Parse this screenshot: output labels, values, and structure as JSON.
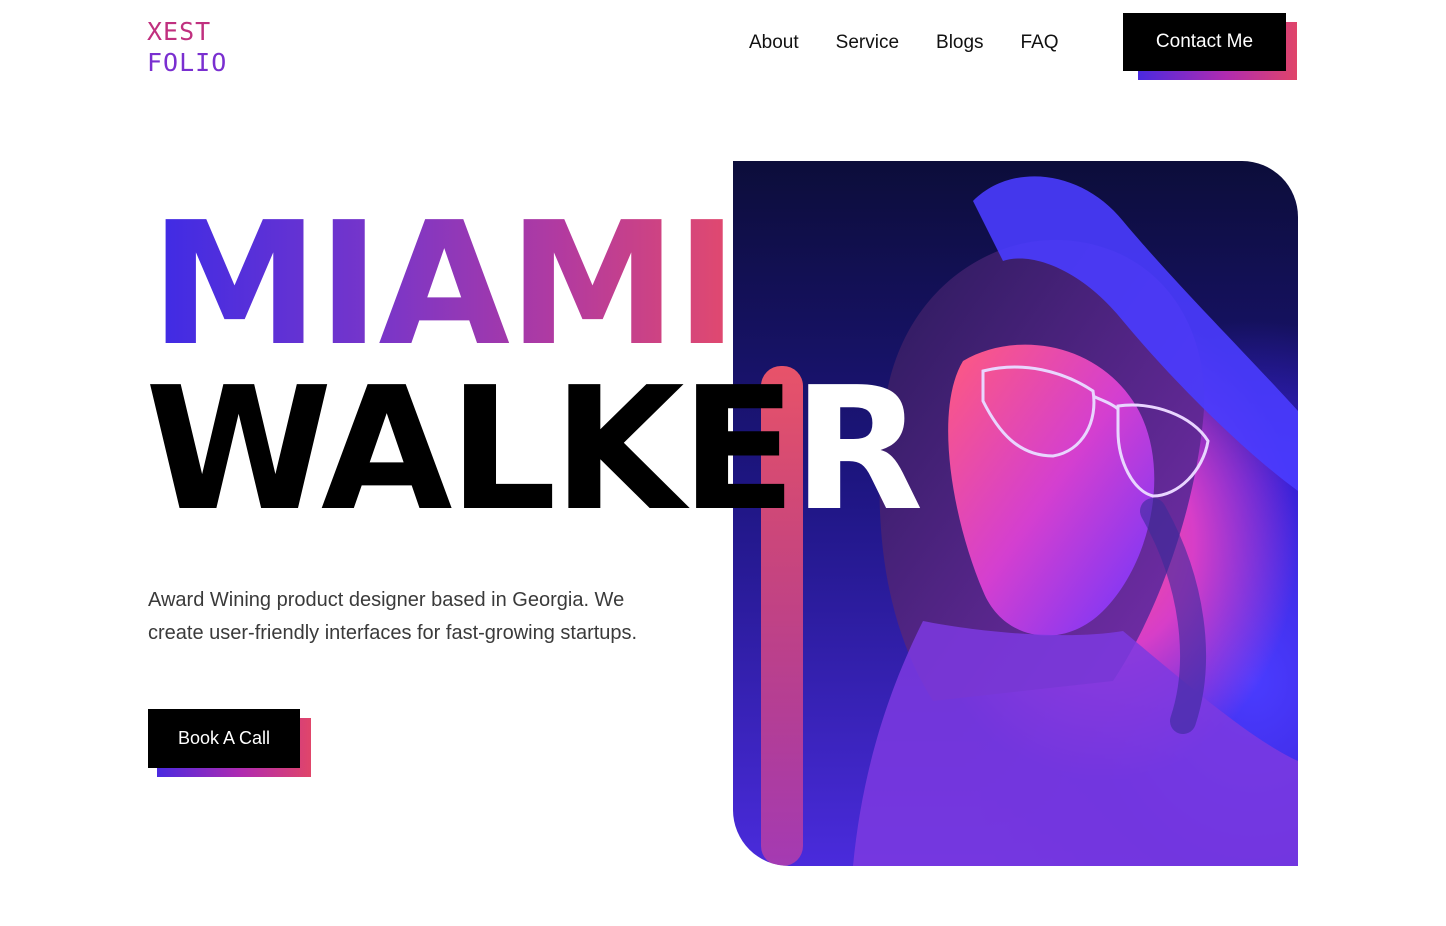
{
  "logo": {
    "line1": "XEST",
    "line2": "FOLIO"
  },
  "nav": {
    "items": [
      "About",
      "Service",
      "Blogs",
      "FAQ"
    ]
  },
  "contact_button": "Contact Me",
  "hero": {
    "first_name": "MIAMI",
    "last_name_main": "WALKE",
    "last_name_tail": "R",
    "tagline_line1": "Award Wining product designer based in Georgia. We",
    "tagline_line2": "create user-friendly interfaces for fast-growing startups.",
    "cta_label": "Book A Call"
  },
  "colors": {
    "gradient_start": "#3d2be6",
    "gradient_end": "#e34a6c",
    "button_bg": "#000000"
  }
}
